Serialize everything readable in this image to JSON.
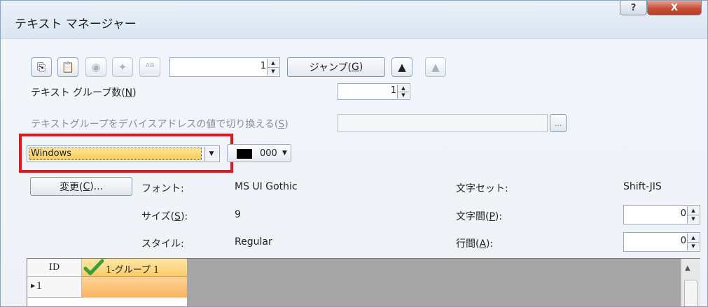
{
  "window": {
    "title": "テキスト マネージャー",
    "help": "?",
    "close": "X"
  },
  "toolbar": {
    "icons": [
      "copy-icon",
      "paste-icon",
      "import-icon",
      "settings-icon",
      "abc-icon"
    ],
    "page_value": "1",
    "jump_label": "ジャンプ(",
    "jump_key": "G",
    "jump_end": ")"
  },
  "group_count": {
    "label": "テキスト グループ数(",
    "key": "N",
    "end": ")",
    "value": "1"
  },
  "device_switch": {
    "label": "テキストグループをデバイスアドレスの値で切り換える(",
    "key": "S",
    "end": ")",
    "browse": "..."
  },
  "font_mode": {
    "value": "Windows"
  },
  "color": {
    "value": "000",
    "swatch": "#000000"
  },
  "font": {
    "change_label": "変更(",
    "change_key": "C",
    "change_end": ")...",
    "font_label": "フォント:",
    "font_value": "MS UI Gothic",
    "size_label": "サイズ(",
    "size_key": "S",
    "size_end": "):",
    "size_value": "9",
    "style_label": "スタイル:",
    "style_value": "Regular",
    "charset_label": "文字セット:",
    "charset_value": "Shift-JIS",
    "spacing_label": "文字間(",
    "spacing_key": "P",
    "spacing_end": "):",
    "spacing_value": "0",
    "line_label": "行間(",
    "line_key": "A",
    "line_end": "):",
    "line_value": "0"
  },
  "grid": {
    "id_header": "ID",
    "group_header": "1-グループ 1",
    "row_id": "1"
  },
  "highlight_color": "#e8141c"
}
